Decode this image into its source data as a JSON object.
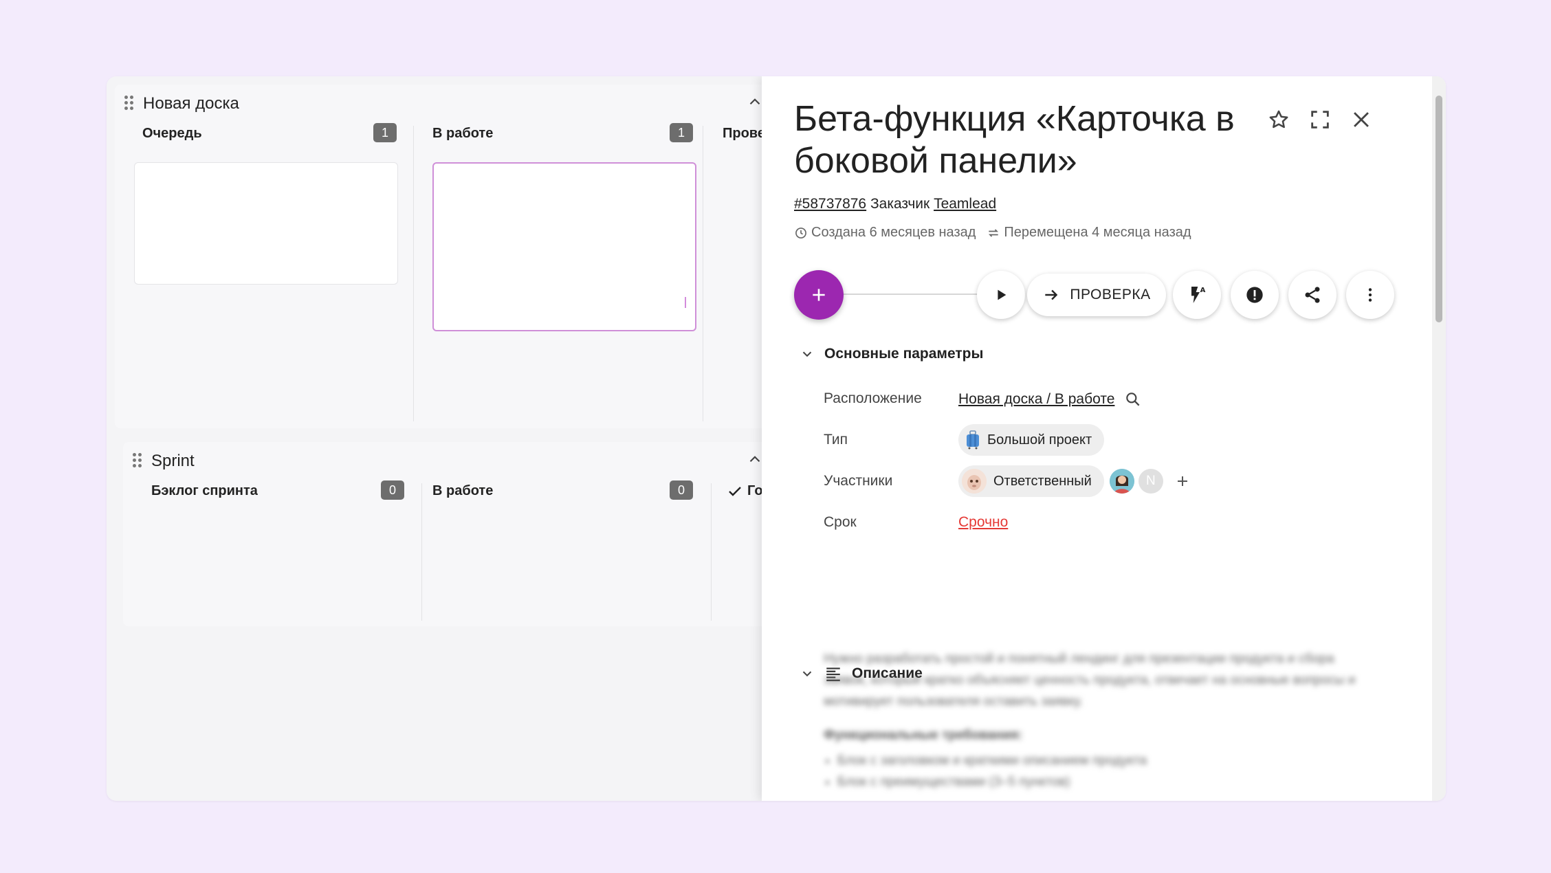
{
  "boards": [
    {
      "title": "Новая доска",
      "columns": [
        {
          "title": "Очередь",
          "count": "1"
        },
        {
          "title": "В работе",
          "count": "1"
        },
        {
          "title": "Провер"
        }
      ]
    },
    {
      "title": "Sprint",
      "columns": [
        {
          "title": "Бэклог спринта",
          "count": "0"
        },
        {
          "title": "В работе",
          "count": "0"
        },
        {
          "title": "Го"
        }
      ]
    }
  ],
  "panel": {
    "title": "Бета-функция «Карточка в боковой панели»",
    "id": "#58737876",
    "customer_label": "Заказчик",
    "customer": "Teamlead",
    "created": "Создана 6 месяцев назад",
    "moved": "Перемещена 4 месяца назад",
    "next_stage": "ПРОВЕРКА",
    "main_section": "Основные параметры",
    "fields": {
      "location_label": "Расположение",
      "location_value": "Новая доска / В работе",
      "type_label": "Тип",
      "type_value": "Большой проект",
      "members_label": "Участники",
      "members_value": "Ответственный",
      "member_initial": "N",
      "due_label": "Срок",
      "due_value": "Срочно"
    },
    "description_section": "Описание",
    "description": {
      "p1": "Нужно разработать простой и понятный лендинг для презентации продукта и сбора заявок, который кратко объясняет ценность продукта, отвечает на основные вопросы и мотивирует пользователя оставить заявку.",
      "heading": "Функциональные требования:",
      "items": [
        "Блок с заголовком и краткими описанием продукта",
        "Блок с преимуществами (3–5 пунктов)"
      ]
    }
  },
  "colors": {
    "accent": "#9c27b0",
    "due": "#e53935",
    "background": "#f3ebfc"
  }
}
